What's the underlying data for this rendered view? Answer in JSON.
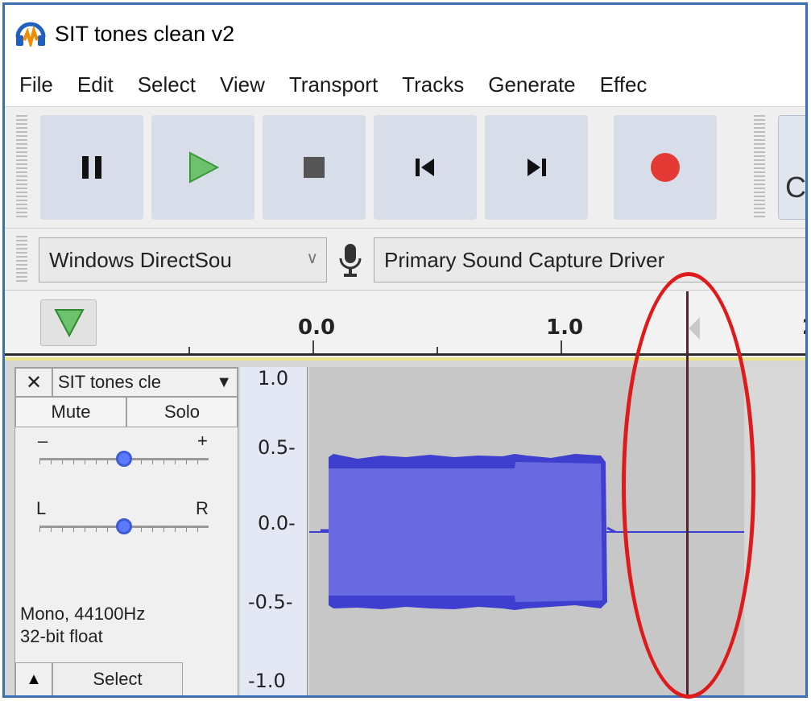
{
  "window": {
    "title": "SIT tones clean v2",
    "icon": "audacity-headphones-icon"
  },
  "menu": [
    "File",
    "Edit",
    "Select",
    "View",
    "Transport",
    "Tracks",
    "Generate",
    "Effec"
  ],
  "transport": {
    "buttons": [
      {
        "name": "pause",
        "icon": "pause-icon"
      },
      {
        "name": "play",
        "icon": "play-icon",
        "color": "#4caf50"
      },
      {
        "name": "stop",
        "icon": "stop-icon"
      },
      {
        "name": "skip-to-start",
        "icon": "skip-start-icon"
      },
      {
        "name": "skip-to-end",
        "icon": "skip-end-icon"
      },
      {
        "name": "record",
        "icon": "record-icon",
        "color": "#e53935"
      }
    ],
    "partial_glyph": "C"
  },
  "device": {
    "host": "Windows DirectSou",
    "input": "Primary Sound Capture Driver",
    "mic_icon": "microphone-icon"
  },
  "ruler": {
    "labels": [
      "0.0",
      "1.0",
      "2"
    ]
  },
  "track": {
    "name": "SIT tones cle",
    "mute": "Mute",
    "solo": "Solo",
    "gain_minus": "–",
    "gain_plus": "+",
    "pan_left": "L",
    "pan_right": "R",
    "format_line1": "Mono, 44100Hz",
    "format_line2": "32-bit float",
    "select": "Select",
    "gain": 0.5,
    "pan": 0.5
  },
  "vruler": {
    "labels": [
      "1.0",
      "0.5-",
      "0.0-",
      "-0.5-",
      "-1.0"
    ]
  },
  "colors": {
    "waveform": "#3f3fcf",
    "waveform_rms": "#6a6ae0",
    "highlight": "#e01a1a"
  }
}
